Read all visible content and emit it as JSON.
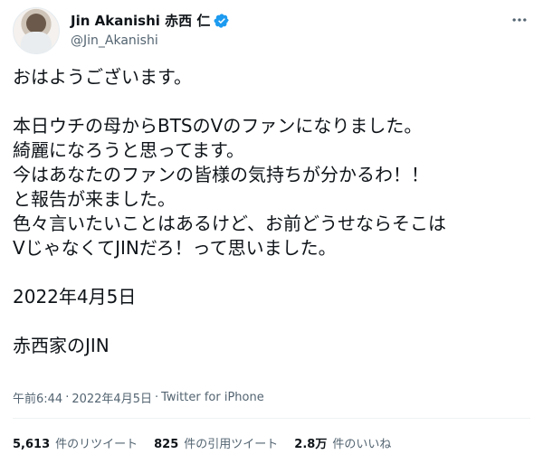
{
  "user": {
    "display_name": "Jin Akanishi 赤西 仁",
    "handle": "@Jin_Akanishi",
    "verified_icon": "verified-badge-icon",
    "accent": "#1d9bf0"
  },
  "tweet": {
    "lines": [
      "おはようございます。",
      "",
      "本日ウチの母からBTSのVのファンになりました。",
      "綺麗になろうと思ってます。",
      "今はあなたのファンの皆様の気持ちが分かるわ！！",
      "と報告が来ました。",
      "色々言いたいことはあるけど、お前どうせならそこは",
      "VじゃなくてJINだろ！って思いました。",
      "",
      "2022年4月5日",
      "",
      "赤西家のJIN"
    ]
  },
  "meta": {
    "time": "午前6:44",
    "separator": "·",
    "date": "2022年4月5日",
    "separator2": "·",
    "source": "Twitter for iPhone"
  },
  "stats": {
    "retweets_count": "5,613",
    "retweets_label": "件のリツイート",
    "quotes_count": "825",
    "quotes_label": "件の引用ツイート",
    "likes_count": "2.8万",
    "likes_label": "件のいいね"
  },
  "icons": {
    "more": "more-horizontal-icon"
  }
}
